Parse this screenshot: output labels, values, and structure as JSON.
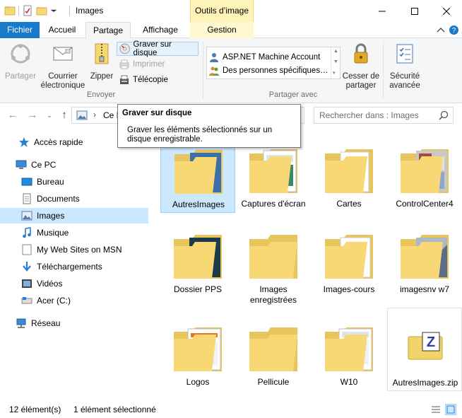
{
  "window": {
    "title": "Images",
    "contextual_tab": "Outils d’image",
    "folder_color": "#f8d775"
  },
  "tabs": [
    "Fichier",
    "Accueil",
    "Partage",
    "Affichage",
    "Gestion"
  ],
  "ribbon": {
    "send": {
      "partager": "Partager",
      "email_line1": "Courrier",
      "email_line2": "électronique",
      "zip": "Zipper",
      "burn": "Graver sur disque",
      "print": "Imprimer",
      "fax": "Télécopie",
      "group": "Envoyer"
    },
    "share_with": {
      "items": [
        "ASP.NET Machine Account",
        "Des personnes spécifiques…"
      ],
      "stop_line1": "Cesser de",
      "stop_line2": "partager",
      "group": "Partager avec"
    },
    "security": {
      "line1": "Sécurité",
      "line2": "avancée"
    }
  },
  "address": {
    "path_segment": "Ce P",
    "search_placeholder": "Rechercher dans : Images"
  },
  "tooltip": {
    "title": "Graver sur disque",
    "body": "Graver les éléments sélectionnés sur un disque enregistrable."
  },
  "nav": {
    "items": [
      {
        "label": "Accès rapide",
        "icon": "star-icon"
      },
      {
        "label": "Ce PC",
        "icon": "computer-icon"
      },
      {
        "label": "Bureau",
        "icon": "desktop-icon"
      },
      {
        "label": "Documents",
        "icon": "documents-icon"
      },
      {
        "label": "Images",
        "icon": "pictures-icon"
      },
      {
        "label": "Musique",
        "icon": "music-icon"
      },
      {
        "label": "My Web Sites on MSN",
        "icon": "web-icon"
      },
      {
        "label": "Téléchargements",
        "icon": "download-icon"
      },
      {
        "label": "Vidéos",
        "icon": "video-icon"
      },
      {
        "label": "Acer (C:)",
        "icon": "drive-icon"
      },
      {
        "label": "Réseau",
        "icon": "network-icon"
      }
    ],
    "selected": "Images"
  },
  "files": [
    {
      "name": "AutresImages",
      "type": "folder",
      "selected": true
    },
    {
      "name": "Captures d'écran",
      "type": "folder"
    },
    {
      "name": "Cartes",
      "type": "folder"
    },
    {
      "name": "ControlCenter4",
      "type": "folder"
    },
    {
      "name": "Dossier PPS",
      "type": "folder"
    },
    {
      "name": "Images enregistrées",
      "type": "folder"
    },
    {
      "name": "Images-cours",
      "type": "folder"
    },
    {
      "name": "imagesnv w7",
      "type": "folder"
    },
    {
      "name": "Logos",
      "type": "folder"
    },
    {
      "name": "Pellicule",
      "type": "folder"
    },
    {
      "name": "W10",
      "type": "folder"
    },
    {
      "name": "AutresImages.zip",
      "type": "zip"
    }
  ],
  "status": {
    "count": "12 élément(s)",
    "selection": "1 élément sélectionné"
  }
}
